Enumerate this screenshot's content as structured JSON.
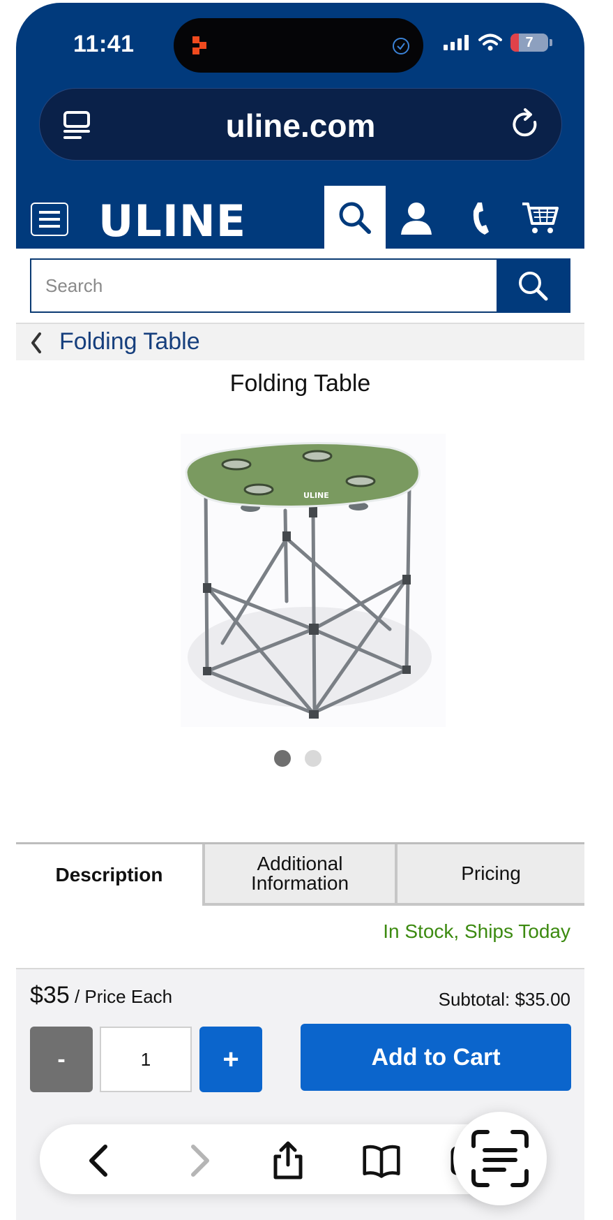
{
  "status_bar": {
    "time": "11:41",
    "battery": "7",
    "icons": [
      "signal-icon",
      "wifi-icon",
      "battery-icon"
    ]
  },
  "browser": {
    "domain": "uline.com",
    "icons": [
      "reader-icon",
      "reload-icon"
    ]
  },
  "site_nav": {
    "logo": "ULINE",
    "icons": [
      "menu-icon",
      "search-icon",
      "account-icon",
      "phone-icon",
      "cart-icon"
    ]
  },
  "search": {
    "placeholder": "Search"
  },
  "breadcrumb": {
    "label": "Folding Table"
  },
  "product": {
    "title": "Folding Table",
    "image_logo": "ULINE",
    "image_count": 2,
    "active_image": 1,
    "tabs": [
      {
        "line1": "Description",
        "line2": ""
      },
      {
        "line1": "Additional",
        "line2": "Information"
      },
      {
        "line1": "Pricing",
        "line2": ""
      }
    ],
    "active_tab": 0,
    "stock": "In Stock, Ships Today",
    "price": "$35",
    "price_unit": " / Price Each",
    "subtotal": "Subtotal: $35.00",
    "qty_minus": "-",
    "qty": "1",
    "qty_plus": "+",
    "add_to_cart": "Add to Cart"
  },
  "toolbar": {
    "icons": [
      "back-icon",
      "forward-icon",
      "share-icon",
      "bookmarks-icon",
      "tabs-icon",
      "scan-text-icon"
    ]
  },
  "colors": {
    "navy": "#013a7c",
    "blue": "#0b65cc",
    "green": "#3c8a10"
  }
}
